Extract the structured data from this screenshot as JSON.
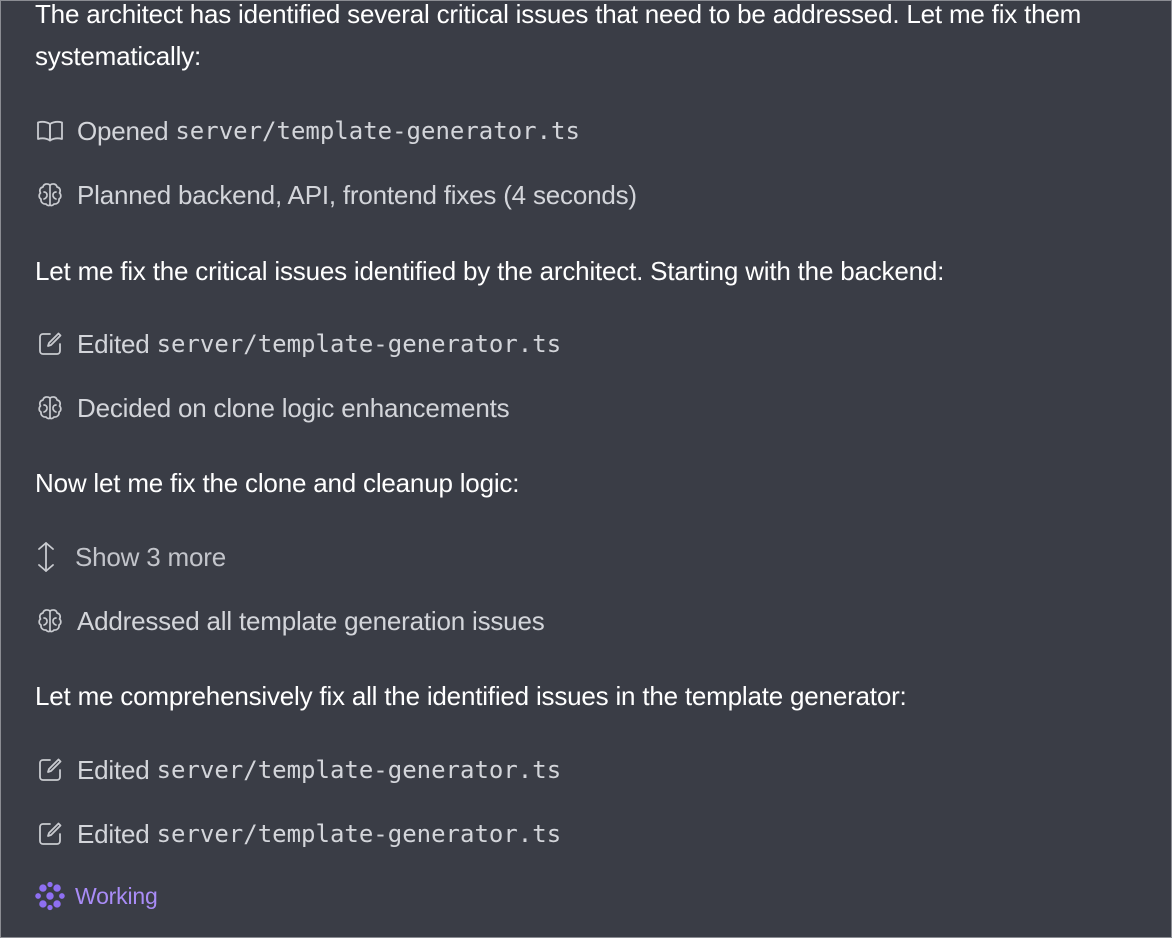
{
  "paragraphs": {
    "p1": "The architect has identified several critical issues that need to be addressed. Let me fix them systematically:",
    "p2": "Let me fix the critical issues identified by the architect. Starting with the backend:",
    "p3": "Now let me fix the clone and cleanup logic:",
    "p4": "Let me comprehensively fix all the identified issues in the template generator:"
  },
  "steps": {
    "opened": {
      "verb": "Opened",
      "file": "server/template-generator.ts",
      "icon": "book-icon"
    },
    "planned": {
      "text": "Planned backend, API, frontend fixes (4 seconds)",
      "icon": "brain-icon"
    },
    "edited1": {
      "verb": "Edited",
      "file": "server/template-generator.ts",
      "icon": "edit-file-icon"
    },
    "decided": {
      "text": "Decided on clone logic enhancements",
      "icon": "brain-icon"
    },
    "show_more": {
      "text": "Show 3 more",
      "icon": "expand-vertical-icon"
    },
    "addressed": {
      "text": "Addressed all template generation issues",
      "icon": "brain-icon"
    },
    "edited2": {
      "verb": "Edited",
      "file": "server/template-generator.ts",
      "icon": "edit-file-icon"
    },
    "edited3": {
      "verb": "Edited",
      "file": "server/template-generator.ts",
      "icon": "edit-file-icon"
    }
  },
  "status": {
    "text": "Working",
    "icon": "agent-working-icon",
    "color": "#a98cf7"
  },
  "colors": {
    "background": "#3a3d46",
    "text": "#ffffff",
    "muted": "#d3d5da",
    "accent": "#a98cf7"
  }
}
